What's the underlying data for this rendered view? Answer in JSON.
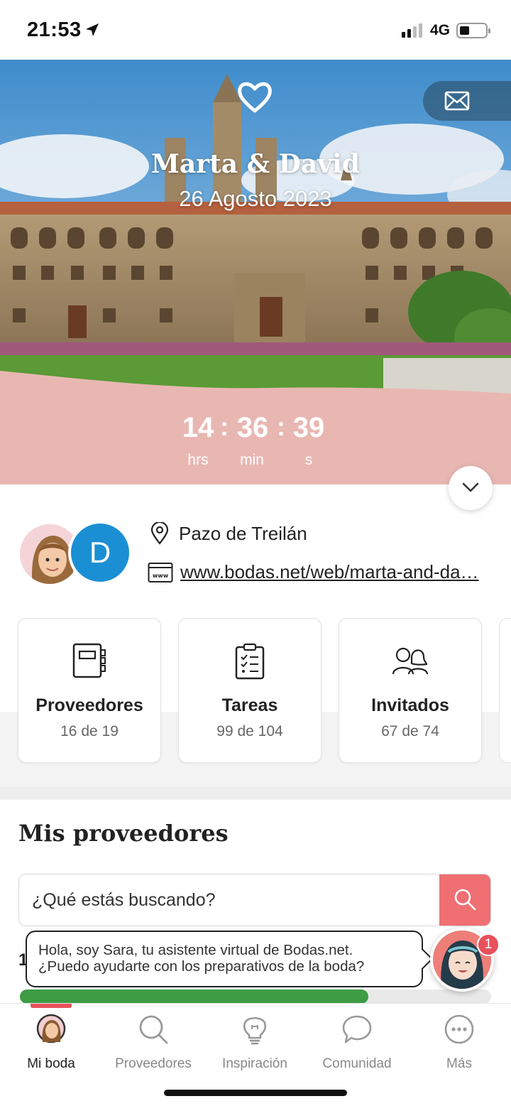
{
  "status_bar": {
    "time": "21:53",
    "network": "4G"
  },
  "hero": {
    "couple_names": "Marta & David",
    "wedding_date": "26 Agosto 2023",
    "countdown": {
      "hours": "14",
      "hours_label": "hrs",
      "minutes": "36",
      "minutes_label": "min",
      "seconds": "39",
      "seconds_label": "s",
      "separator": ":"
    }
  },
  "couple": {
    "avatar_initial": "D",
    "venue": "Pazo de Treilán",
    "website": "www.bodas.net/web/marta-and-da…"
  },
  "stats": [
    {
      "title": "Proveedores",
      "subtitle": "16 de 19",
      "icon": "notebook-icon"
    },
    {
      "title": "Tareas",
      "subtitle": "99 de 104",
      "icon": "checklist-icon"
    },
    {
      "title": "Invitados",
      "subtitle": "67 de 74",
      "icon": "guests-icon"
    }
  ],
  "vendors": {
    "title": "Mis proveedores",
    "search_placeholder": "¿Qué estás buscando?",
    "partial_digit": "1",
    "progress_fraction": 0.74
  },
  "assistant": {
    "message_line1": "Hola, soy Sara, tu asistente virtual de Bodas.net.",
    "message_line2": "¿Puedo ayudarte con los preparativos de la boda?",
    "badge_count": "1"
  },
  "tab_bar": {
    "tabs": [
      {
        "label": "Mi boda",
        "icon": "avatar-icon",
        "active": true
      },
      {
        "label": "Proveedores",
        "icon": "search-icon",
        "active": false
      },
      {
        "label": "Inspiración",
        "icon": "lightbulb-icon",
        "active": false
      },
      {
        "label": "Comunidad",
        "icon": "chat-bubble-icon",
        "active": false
      },
      {
        "label": "Más",
        "icon": "more-icon",
        "active": false
      }
    ]
  },
  "colors": {
    "accent": "#ef6f73",
    "hero_pink": "#e9b7b2",
    "progress_green": "#3e9c45",
    "avatar_blue": "#1b8fd4"
  }
}
